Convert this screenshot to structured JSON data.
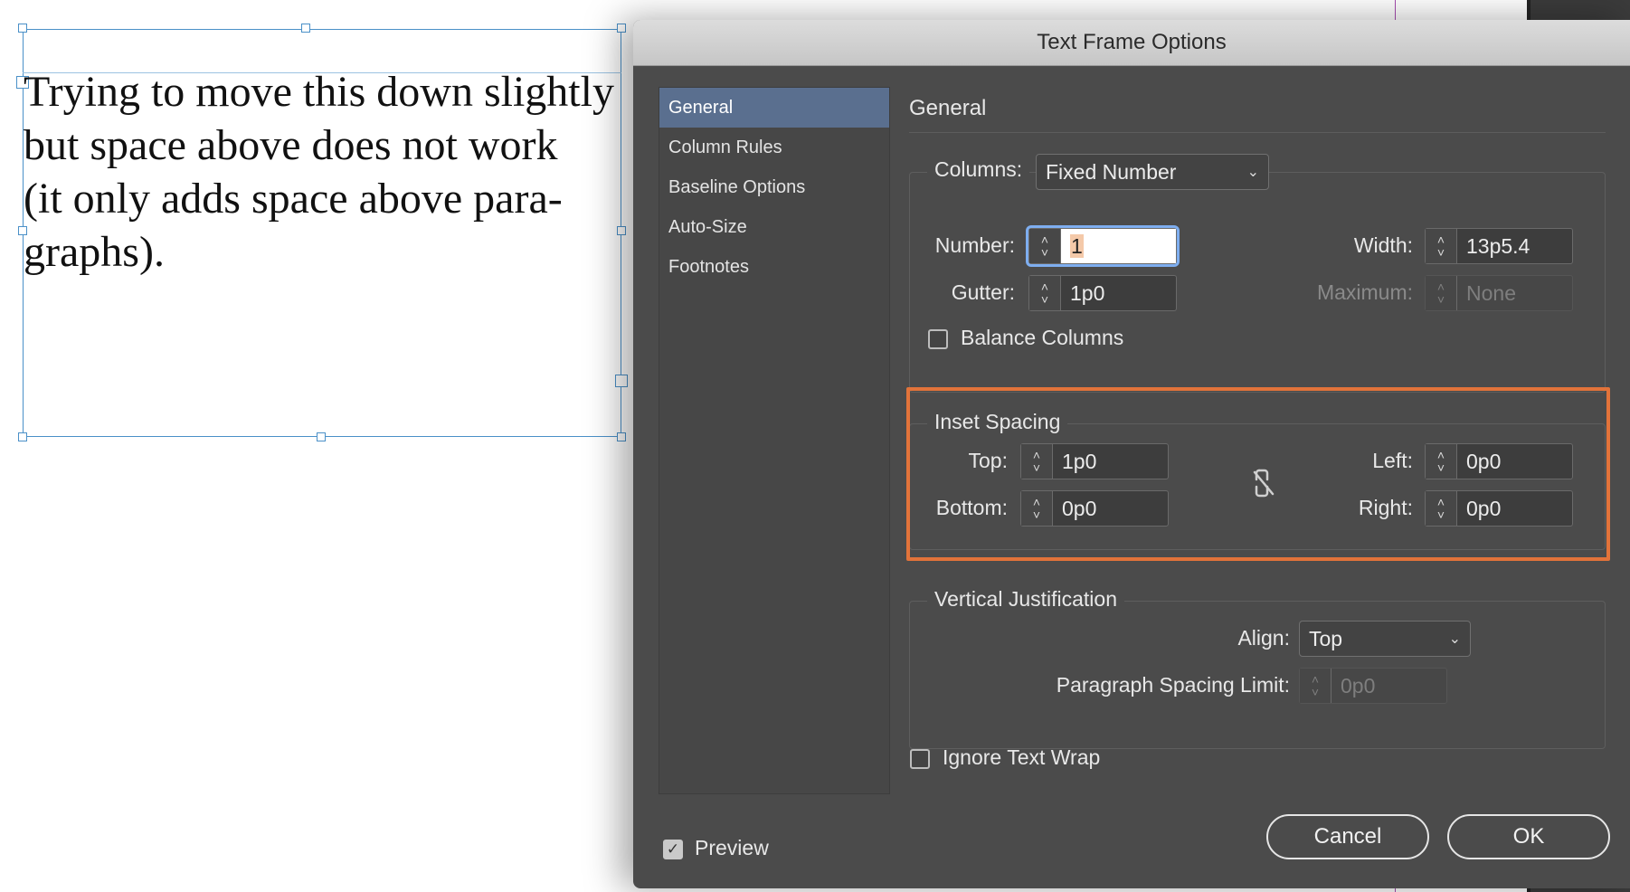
{
  "document": {
    "frame_text": "Trying to move this down slightly\nbut space above does not work\n(it only adds space above para-\ngraphs)."
  },
  "dialog": {
    "title": "Text Frame Options",
    "sidebar": {
      "items": [
        {
          "label": "General",
          "active": true
        },
        {
          "label": "Column Rules"
        },
        {
          "label": "Baseline Options"
        },
        {
          "label": "Auto-Size"
        },
        {
          "label": "Footnotes"
        }
      ]
    },
    "section_title": "General",
    "columns": {
      "label": "Columns:",
      "type_value": "Fixed Number",
      "number_label": "Number:",
      "number_value": "1",
      "gutter_label": "Gutter:",
      "gutter_value": "1p0",
      "width_label": "Width:",
      "width_value": "13p5.4",
      "maximum_label": "Maximum:",
      "maximum_value": "None",
      "balance_label": "Balance Columns",
      "balance_checked": false
    },
    "inset_spacing": {
      "label": "Inset Spacing",
      "top_label": "Top:",
      "top_value": "1p0",
      "bottom_label": "Bottom:",
      "bottom_value": "0p0",
      "left_label": "Left:",
      "left_value": "0p0",
      "right_label": "Right:",
      "right_value": "0p0",
      "link_icon": "broken-chain-icon"
    },
    "vertical_justification": {
      "label": "Vertical Justification",
      "align_label": "Align:",
      "align_value": "Top",
      "para_limit_label": "Paragraph Spacing Limit:",
      "para_limit_value": "0p0"
    },
    "ignore_wrap": {
      "label": "Ignore Text Wrap",
      "checked": false
    },
    "preview": {
      "label": "Preview",
      "checked": true
    },
    "buttons": {
      "cancel": "Cancel",
      "ok": "OK"
    },
    "colors": {
      "highlight": "#e2733a",
      "selected_item": "#5a6f8f",
      "dialog_bg": "#4b4b4b"
    }
  }
}
